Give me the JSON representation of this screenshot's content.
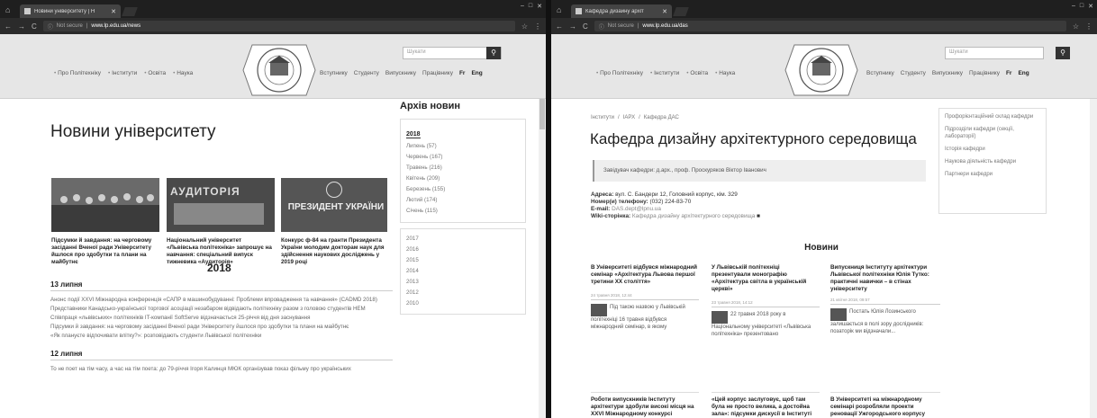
{
  "left": {
    "tab_title": "Новини університету | Н",
    "url_prefix": "Not secure",
    "url": "www.lp.edu.ua/news",
    "search_placeholder": "Шукати",
    "nav": [
      "Про Політехніку",
      "Інститути",
      "Освіта",
      "Наука"
    ],
    "nav_right": [
      "Вступнику",
      "Студенту",
      "Випускнику",
      "Працівнику"
    ],
    "lang_fr": "Fr",
    "lang_eng": "Eng",
    "page_title": "Новини університету",
    "archive_title": "Архів новин",
    "archive_year": "2018",
    "archive_months": [
      "Липень (57)",
      "Червень (167)",
      "Травень (216)",
      "Квітень (209)",
      "Березень (155)",
      "Лютий (174)",
      "Січень (115)"
    ],
    "archive_years": [
      "2017",
      "2016",
      "2015",
      "2014",
      "2013",
      "2012",
      "2010"
    ],
    "cards": [
      "Підсумки й завдання: на черговому засіданні Вченої ради Університету йшлося про здобутки та плани на майбутнє",
      "Національний університет «Львівська політехніка» запрошує на навчання: спеціальний випуск тижневика «Аудиторія»",
      "Конкурс ф-84 на гранти Президента України молодим докторам наук для здійснення наукових досліджень у 2019 році"
    ],
    "card2_photo_text": "АУДИТОРІЯ",
    "card3_photo_text": "ПРЕЗИДЕНТ УКРАЇНИ",
    "year_heading": "2018",
    "day1": "13 липня",
    "day1_items": [
      "Анонс події XXVI Міжнародна конференція «САПР в машинобудуванні: Проблеми впровадження та навчання» (CADMD 2018)",
      "Представники Канадсько-української торгової асоціації незабаром відвідають політехніку разом з головою студентів НЕМ",
      "Співпраця «львівських» політехніків IT-компанії SoftServe відзначається 25-річчя від дня заснування",
      "Підсумки й завдання: на черговому засіданні Вченої ради Університету йшлося про здобутки та плани на майбутнє",
      "«Як плануєте відпочивати влітку?»: розповідають студенти Львівської політехніки"
    ],
    "day2": "12 липня",
    "day2_items": [
      "То не поет на тім часу, а час на тім поета: до 79-річчя Ігоря Калинця МЮК організував показ фільму про українських"
    ]
  },
  "right": {
    "tab_title": "Кафедра дизайну архіт",
    "url_prefix": "Not secure",
    "url": "www.lp.edu.ua/das",
    "search_placeholder": "Шукати",
    "nav": [
      "Про Політехніку",
      "Інститути",
      "Освіта",
      "Наука"
    ],
    "nav_right": [
      "Вступнику",
      "Студенту",
      "Випускнику",
      "Працівнику"
    ],
    "lang_fr": "Fr",
    "lang_eng": "Eng",
    "breadcrumb": [
      "Інститути",
      "ІАРХ",
      "Кафедра ДАС"
    ],
    "page_title": "Кафедра дизайну архітектурного середовища",
    "head_quote": "Завідувач кафедри: д.арх., проф. Проскуряков Віктор Іванович",
    "addr_label": "Адреса:",
    "addr": "вул. С. Бандери 12, Головний корпус, кім. 329",
    "phone_label": "Номер(и) телефону:",
    "phone": "(032) 224-83-70",
    "email_label": "E-mail:",
    "email": "DAS.dept@lpnu.ua",
    "wiki_label": "Wiki-сторінка:",
    "wiki": "Кафедра дизайну архітектурного середовища",
    "side_links": [
      "Профорієнтаційний склад кафедри",
      "Підрозділи кафедри (секції, лабораторії)",
      "Історія кафедри",
      "Наукова діяльність кафедри",
      "Партнери кафедри"
    ],
    "news_heading": "Новини",
    "news": [
      {
        "title": "В Університеті відбувся міжнародний семінар «Архітектура Львова першої третини ХХ століття»",
        "date": "24 травня 2018, 12:44",
        "text": "Під такою назвою у Львівській політехніці 16 травня відбувся міжнародний семінар, в якому"
      },
      {
        "title": "У Львівській політехніці презентували монографію «Архітектура світла в українській церкві»",
        "date": "23 травня 2018, 14:12",
        "text": "22 травня 2018 року в Національному університеті «Львівська політехніка» презентовано"
      },
      {
        "title": "Випускниця Інституту архітектури Львівської політехніки Юлія Тутко: практичні навички – в стінах університету",
        "date": "21 квітня 2018, 09:57",
        "text": "Постать Юлія Лозинського залишається в полі зору дослідників: позаторік ми відзначали..."
      }
    ],
    "news_row2": [
      "Роботи випускників Інституту архітектури здобули високі місця на XXVI Міжнародному конкурсі дипломних проектів",
      "«Цей корпус заслуговує, щоб там була не просто велика, а достойна зала»: підсумки дискусії в Інституті",
      "В Університеті на міжнародному семінарі розробляли проекти реновації Ужгородського корпусу"
    ]
  }
}
